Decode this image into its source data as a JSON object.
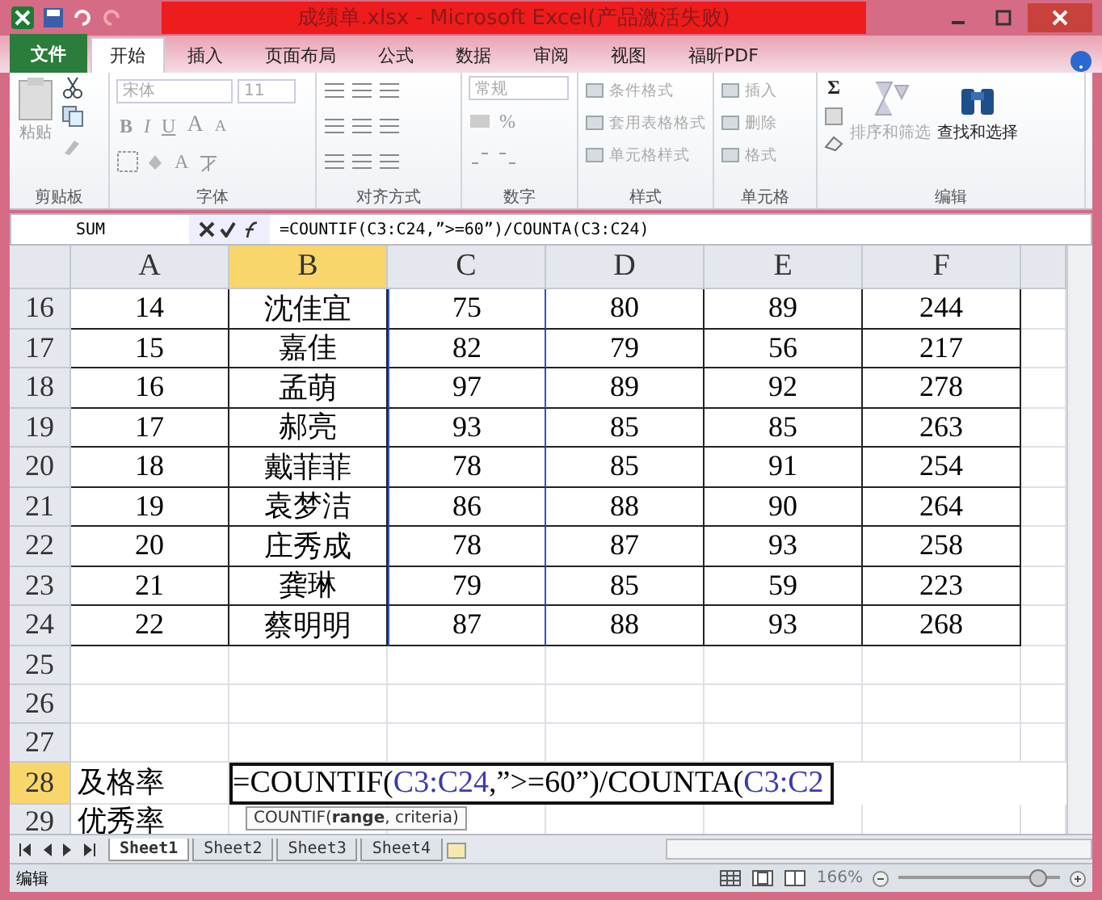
{
  "window": {
    "title": "成绩单.xlsx - Microsoft Excel(产品激活失败)"
  },
  "tabs": [
    {
      "label": "文件",
      "kind": "file",
      "selected": false
    },
    {
      "label": "开始",
      "kind": "tab",
      "selected": true
    },
    {
      "label": "插入",
      "kind": "tab",
      "selected": false
    },
    {
      "label": "页面布局",
      "kind": "tab",
      "selected": false
    },
    {
      "label": "公式",
      "kind": "tab",
      "selected": false
    },
    {
      "label": "数据",
      "kind": "tab",
      "selected": false
    },
    {
      "label": "审阅",
      "kind": "tab",
      "selected": false
    },
    {
      "label": "视图",
      "kind": "tab",
      "selected": false
    },
    {
      "label": "福昕PDF",
      "kind": "tab",
      "selected": false
    }
  ],
  "ribbon": [
    {
      "kind": "clipboard",
      "label": "剪贴板",
      "paste": "粘贴"
    },
    {
      "kind": "font",
      "label": "字体",
      "font": "宋体",
      "size": "11",
      "format_buttons": [
        "B",
        "I",
        "U"
      ],
      "grow": "A",
      "shrink": "A",
      "font_color": "A"
    },
    {
      "kind": "align",
      "label": "对齐方式"
    },
    {
      "kind": "number",
      "label": "数字",
      "format": "常规",
      "percent": "%"
    },
    {
      "kind": "list",
      "label": "样式",
      "items": [
        {
          "label": "条件格式",
          "disabled": true
        },
        {
          "label": "套用表格格式",
          "disabled": true
        },
        {
          "label": "单元格样式",
          "disabled": true
        }
      ]
    },
    {
      "kind": "list",
      "label": "单元格",
      "items": [
        {
          "label": "插入",
          "disabled": true
        },
        {
          "label": "删除",
          "disabled": true
        },
        {
          "label": "格式",
          "disabled": true
        }
      ]
    },
    {
      "kind": "editing",
      "label": "编辑",
      "sum": "Σ",
      "buttons": [
        {
          "label": "排序和筛选",
          "disabled": true
        },
        {
          "label": "查找和选择",
          "disabled": false
        }
      ]
    }
  ],
  "formula_bar": {
    "name_box": "SUM",
    "formula": "=COUNTIF(C3:C24,”>=60”)/COUNTA(C3:C24)"
  },
  "columns": [
    {
      "label": "A",
      "selected": false
    },
    {
      "label": "B",
      "selected": true
    },
    {
      "label": "C",
      "selected": false
    },
    {
      "label": "D",
      "selected": false
    },
    {
      "label": "E",
      "selected": false
    },
    {
      "label": "F",
      "selected": false
    }
  ],
  "rows": [
    {
      "header": "16",
      "kind": "data",
      "selected": false,
      "cells": [
        "14",
        "沈佳宜",
        "75",
        "80",
        "89",
        "244"
      ]
    },
    {
      "header": "17",
      "kind": "data",
      "selected": false,
      "cells": [
        "15",
        "嘉佳",
        "82",
        "79",
        "56",
        "217"
      ]
    },
    {
      "header": "18",
      "kind": "data",
      "selected": false,
      "cells": [
        "16",
        "孟萌",
        "97",
        "89",
        "92",
        "278"
      ]
    },
    {
      "header": "19",
      "kind": "data",
      "selected": false,
      "cells": [
        "17",
        "郝亮",
        "93",
        "85",
        "85",
        "263"
      ]
    },
    {
      "header": "20",
      "kind": "data",
      "selected": false,
      "cells": [
        "18",
        "戴菲菲",
        "78",
        "85",
        "91",
        "254"
      ]
    },
    {
      "header": "21",
      "kind": "data",
      "selected": false,
      "cells": [
        "19",
        "袁梦洁",
        "86",
        "88",
        "90",
        "264"
      ]
    },
    {
      "header": "22",
      "kind": "data",
      "selected": false,
      "cells": [
        "20",
        "庄秀成",
        "78",
        "87",
        "93",
        "258"
      ]
    },
    {
      "header": "23",
      "kind": "data",
      "selected": false,
      "cells": [
        "21",
        "龚琳",
        "79",
        "85",
        "59",
        "223"
      ]
    },
    {
      "header": "24",
      "kind": "data",
      "selected": false,
      "cells": [
        "22",
        "蔡明明",
        "87",
        "88",
        "93",
        "268"
      ]
    },
    {
      "header": "25",
      "kind": "blank",
      "selected": false,
      "cells": []
    },
    {
      "header": "26",
      "kind": "blank",
      "selected": false,
      "cells": []
    },
    {
      "header": "27",
      "kind": "blank",
      "selected": false,
      "cells": []
    },
    {
      "header": "28",
      "kind": "edit",
      "selected": true,
      "cells": [
        "及格率"
      ],
      "formula": [
        {
          "text": "=COUNTIF(",
          "ref": false
        },
        {
          "text": "C3:C24",
          "ref": true
        },
        {
          "text": ",”>=60”)/COUNTA(",
          "ref": false
        },
        {
          "text": "C3:C2",
          "ref": true
        }
      ],
      "tooltip": "COUNTIF(**range**, criteria)"
    },
    {
      "header": "29",
      "kind": "blank",
      "selected": false,
      "cells": [
        "优秀率"
      ]
    }
  ],
  "sheets": [
    {
      "label": "Sheet1",
      "selected": true
    },
    {
      "label": "Sheet2",
      "selected": false
    },
    {
      "label": "Sheet3",
      "selected": false
    },
    {
      "label": "Sheet4",
      "selected": false
    }
  ],
  "status_bar": {
    "mode": "编辑",
    "zoom": "166%",
    "level": 0.9
  }
}
